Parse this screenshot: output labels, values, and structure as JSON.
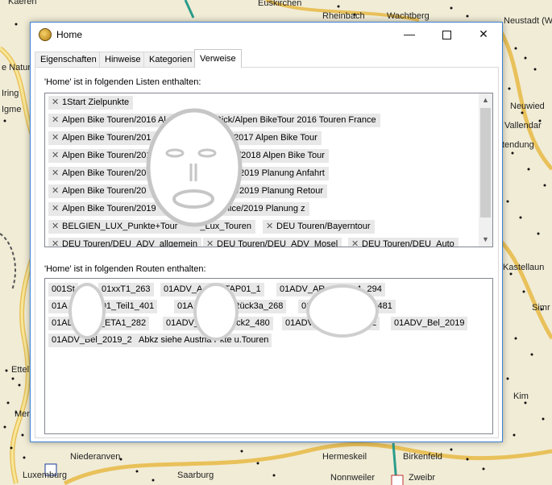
{
  "map": {
    "labels": [
      "Euskirchen",
      "Rheinbach",
      "Wachtberg",
      "Neustadt (Wi",
      "Neuwied",
      "Vallendar",
      "Kastellaun",
      "Simr",
      "Kim",
      "Hermeskeil",
      "Birkenfeld",
      "Nonnweiler",
      "Zweibr",
      "Saarburg",
      "Niederanven",
      "Luxemburg",
      "Ettel",
      "Mer",
      "tendung",
      "e Natur",
      "Iring",
      "Igme",
      "Kaeren"
    ]
  },
  "dialog": {
    "title": "Home",
    "app_icon": "home-app-icon",
    "controls": {
      "minimize": "—",
      "maximize": "□",
      "close": "✕"
    },
    "tabs": [
      {
        "label": "Eigenschaften",
        "active": false
      },
      {
        "label": "Hinweise",
        "active": false
      },
      {
        "label": "Kategorien",
        "active": false
      },
      {
        "label": "Verweise",
        "active": true
      }
    ],
    "lists_label": "'Home' ist in folgenden Listen enthalten:",
    "lists": [
      "1Start Zielpunkte",
      "Alpen Bike Touren/2016 Al",
      ".Rick/Alpen BikeTour 2016 Touren France",
      "Alpen Bike Touren/201",
      "ick/2017 Alpen Bike Tour",
      "Alpen Bike Touren/201",
      "elice/2018 Alpen Bike Tour",
      "Alpen Bike Touren/20",
      "elice/2019 Planung Anfahrt",
      "Alpen Bike Touren/20",
      "elice/2019 Planung Retour",
      "Alpen Bike Touren/2019",
      "nFelice/2019 Planung z",
      "BELGIEN_LUX_Punkte+Tour",
      "_Lux_Touren",
      "DEU Touren/Bayerntour",
      "DEU Touren/DEU_ADV_allgemein",
      "DEU Touren/DEU_ADV_Mosel",
      "DEU Touren/DEU_Auto"
    ],
    "routes_label": "'Home' ist in folgenden Routen enthalten:",
    "routes": [
      "001St",
      "01xxT1_263",
      "01ADV_A",
      "ETAP01_1",
      "01ADV_AR",
      "1_294",
      "01A",
      "8_01_Teil1_401",
      "01A",
      "Rück3a_268",
      "01",
      "5_481",
      "01AL",
      "9_ETA1_282",
      "01ADV_",
      "ück2_480",
      "01ADV_",
      "42",
      "01ADV_Bel_2019",
      "01ADV_Bel_2019_2",
      "Abkz siehe Austria Pkte u.Touren"
    ]
  }
}
